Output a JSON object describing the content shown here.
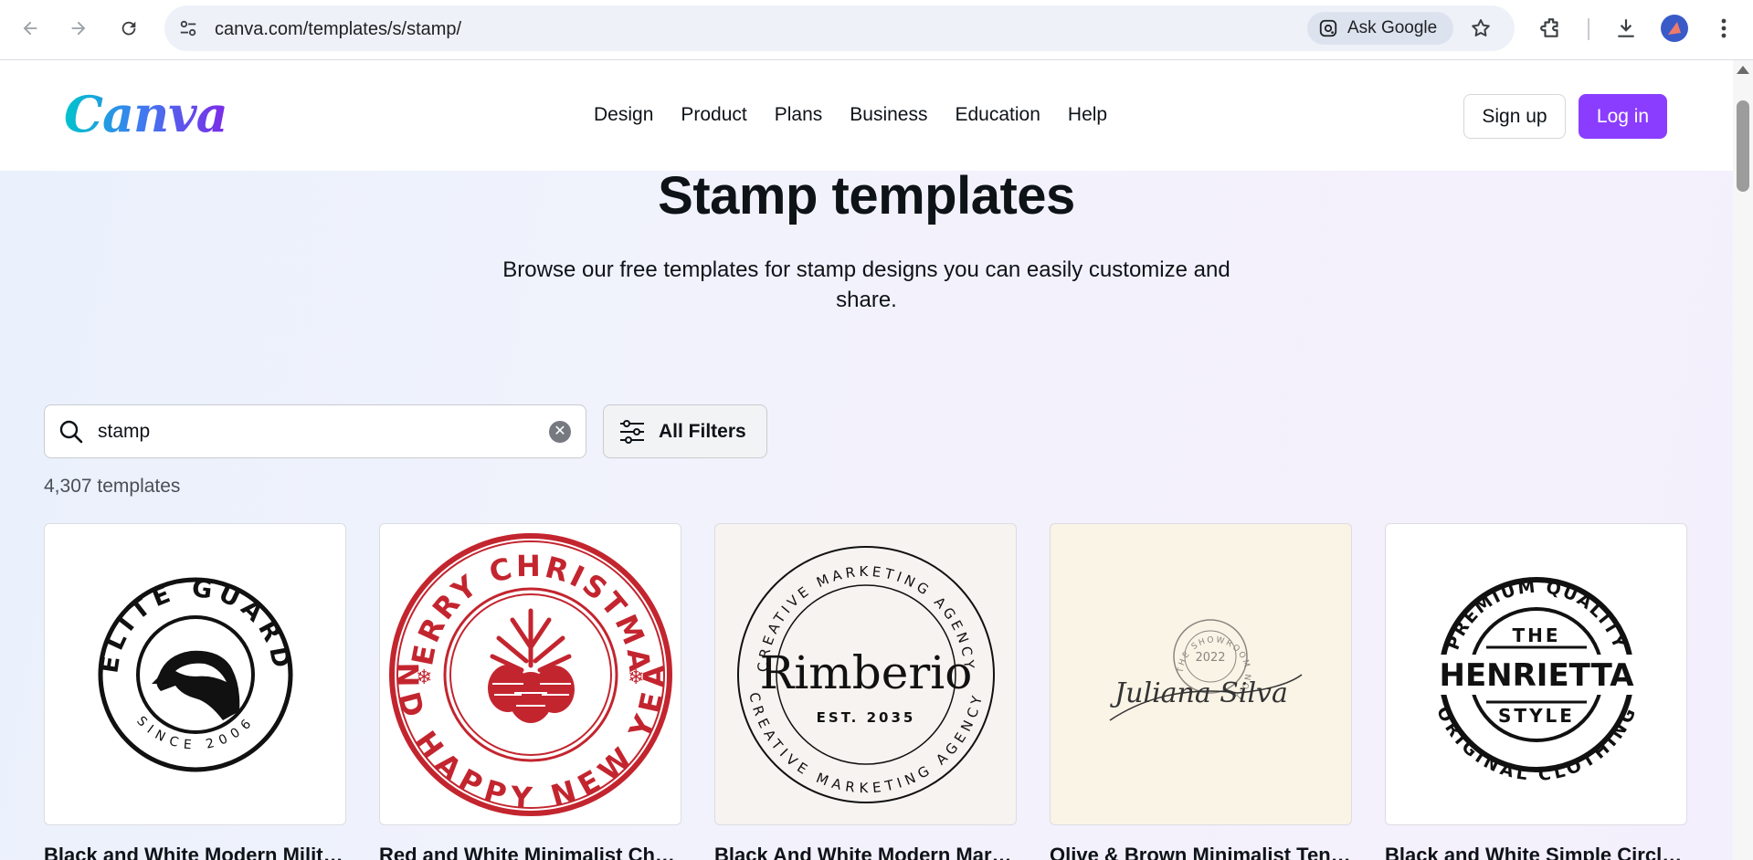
{
  "browser": {
    "url": "canva.com/templates/s/stamp/",
    "ask_google": "Ask Google"
  },
  "header": {
    "logo": "Canva",
    "nav": [
      "Design",
      "Product",
      "Plans",
      "Business",
      "Education",
      "Help"
    ],
    "signup": "Sign up",
    "login": "Log in"
  },
  "hero": {
    "title": "Stamp templates",
    "subtitle": "Browse our free templates for stamp designs you can easily customize and share."
  },
  "search": {
    "value": "stamp",
    "filters_label": "All Filters",
    "count": "4,307 templates"
  },
  "templates": [
    {
      "title": "Black and White Modern Militar...",
      "bg": "#ffffff",
      "art": {
        "top": "ELITE GUARD",
        "bottom": "SINCE 2006"
      }
    },
    {
      "title": "Red and White Minimalist Christ...",
      "bg": "#ffffff",
      "art": {
        "top": "MERRY CHRISTMAS",
        "bottom": "AND HAPPY NEW YEAR"
      }
    },
    {
      "title": "Black And White Modern Market...",
      "bg": "#f7f3f0",
      "art": {
        "top": "CREATIVE MARKETING AGENCY",
        "center": "Rimberio",
        "est": "EST. 2035",
        "bottom": "CREATIVE MARKETING AGENCY"
      }
    },
    {
      "title": "Olive & Brown Minimalist Tende...",
      "bg": "#faf4e6",
      "art": {
        "ring": "THE SHOWROOM NO.1",
        "year": "2022",
        "signature": "Juliana Silva"
      }
    },
    {
      "title": "Black and White Simple Circle L...",
      "bg": "#ffffff",
      "art": {
        "top": "PREMIUM QUALITY",
        "line1": "THE",
        "line2": "HENRIETTA",
        "line3": "STYLE",
        "bottom": "ORIGINAL CLOTHING"
      }
    }
  ],
  "colors": {
    "brand_purple": "#8b3dff",
    "stamp_red": "#c3252f"
  }
}
